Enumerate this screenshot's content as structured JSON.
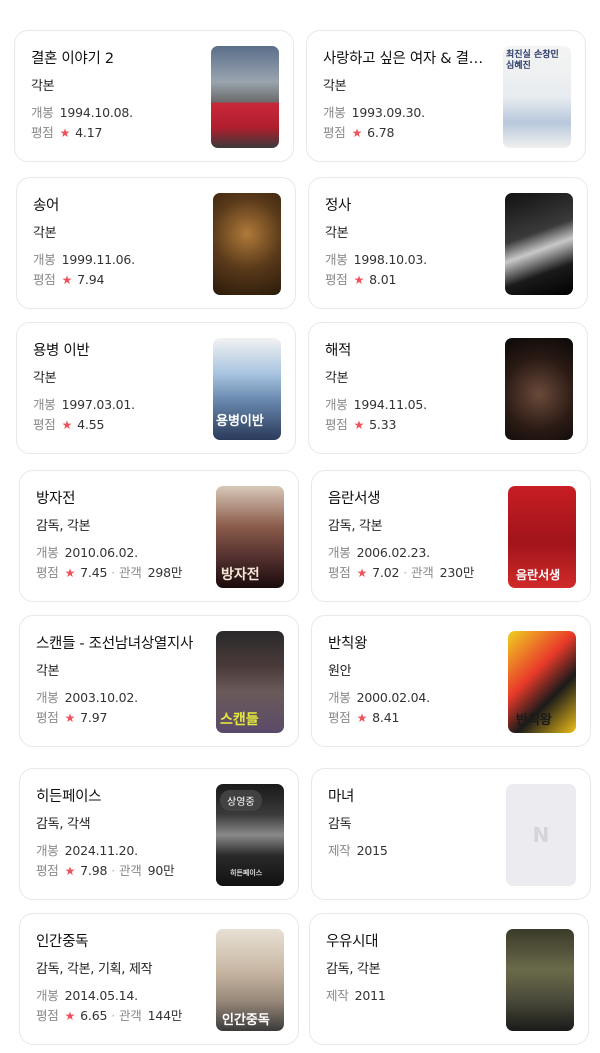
{
  "labels": {
    "release": "개봉",
    "rating": "평점",
    "audience": "관객",
    "production": "제작"
  },
  "movies": [
    {
      "title": "결혼 이야기 2",
      "role": "각본",
      "release": "1994.10.08.",
      "rating": "4.17"
    },
    {
      "title": "사랑하고 싶은 여자 & 결혼하고 싶은 여자",
      "role": "각본",
      "release": "1993.09.30.",
      "rating": "6.78"
    },
    {
      "title": "송어",
      "role": "각본",
      "release": "1999.11.06.",
      "rating": "7.94"
    },
    {
      "title": "정사",
      "role": "각본",
      "release": "1998.10.03.",
      "rating": "8.01"
    },
    {
      "title": "용병 이반",
      "role": "각본",
      "release": "1997.03.01.",
      "rating": "4.55"
    },
    {
      "title": "해적",
      "role": "각본",
      "release": "1994.11.05.",
      "rating": "5.33"
    },
    {
      "title": "방자전",
      "role": "감독, 각본",
      "release": "2010.06.02.",
      "rating": "7.45",
      "audience": "298만"
    },
    {
      "title": "음란서생",
      "role": "감독, 각본",
      "release": "2006.02.23.",
      "rating": "7.02",
      "audience": "230만"
    },
    {
      "title": "스캔들 - 조선남녀상열지사",
      "role": "각본",
      "release": "2003.10.02.",
      "rating": "7.97"
    },
    {
      "title": "반칙왕",
      "role": "원안",
      "release": "2000.02.04.",
      "rating": "8.41"
    },
    {
      "title": "히든페이스",
      "role": "감독, 각색",
      "release": "2024.11.20.",
      "rating": "7.98",
      "audience": "90만",
      "badge": "상영중"
    },
    {
      "title": "마녀",
      "role": "감독",
      "production": "2015",
      "placeholder": "N"
    },
    {
      "title": "인간중독",
      "role": "감독, 각본, 기획, 제작",
      "release": "2014.05.14.",
      "rating": "6.65",
      "audience": "144만"
    },
    {
      "title": "우유시대",
      "role": "감독, 각본",
      "production": "2011"
    }
  ],
  "poster_text": {
    "m1": "최진실  손창민  심혜진",
    "m6": "방자전",
    "m7": "음란서생",
    "m8": "스캔들",
    "m9": "반칙왕",
    "m10": "히든페이스",
    "m12": "인간중독",
    "m4": "용병이반"
  },
  "colors": {
    "star": "#f0505a",
    "border": "#e8e8ec",
    "muted": "#8a8a8a"
  }
}
